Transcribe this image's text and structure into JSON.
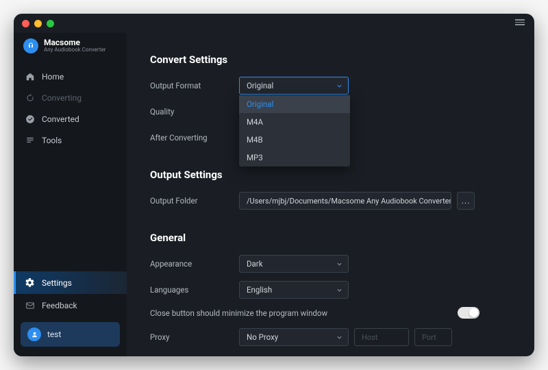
{
  "brand": {
    "name": "Macsome",
    "subtitle": "Any Audiobook Converter"
  },
  "nav": {
    "home": "Home",
    "converting": "Converting",
    "converted": "Converted",
    "tools": "Tools",
    "settings": "Settings",
    "feedback": "Feedback"
  },
  "user": {
    "name": "test"
  },
  "sections": {
    "convert": {
      "title": "Convert Settings",
      "output_format_label": "Output Format",
      "output_format_value": "Original",
      "output_format_options": [
        "Original",
        "M4A",
        "M4B",
        "MP3"
      ],
      "quality_label": "Quality",
      "after_converting_label": "After Converting"
    },
    "output": {
      "title": "Output Settings",
      "folder_label": "Output Folder",
      "folder_value": "/Users/mjbj/Documents/Macsome Any Audiobook Converter",
      "browse": "..."
    },
    "general": {
      "title": "General",
      "appearance_label": "Appearance",
      "appearance_value": "Dark",
      "languages_label": "Languages",
      "languages_value": "English",
      "close_minimize_label": "Close button should minimize the program window",
      "proxy_label": "Proxy",
      "proxy_value": "No Proxy",
      "proxy_host_placeholder": "Host",
      "proxy_port_placeholder": "Port"
    }
  }
}
